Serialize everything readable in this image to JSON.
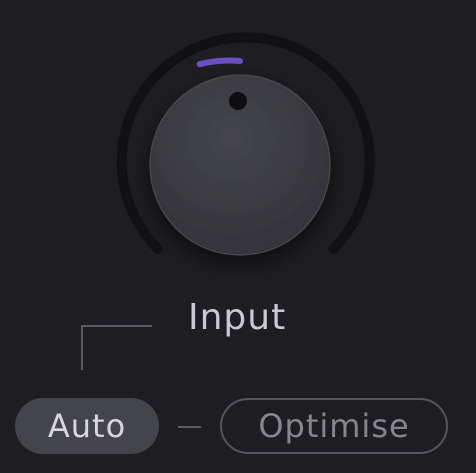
{
  "knob": {
    "label": "Input",
    "value_fraction": 0.5,
    "accent_color": "#6b4fc2",
    "track_color": "#111114"
  },
  "modes": {
    "auto_label": "Auto",
    "optimise_label": "Optimise",
    "selected": "Auto"
  }
}
